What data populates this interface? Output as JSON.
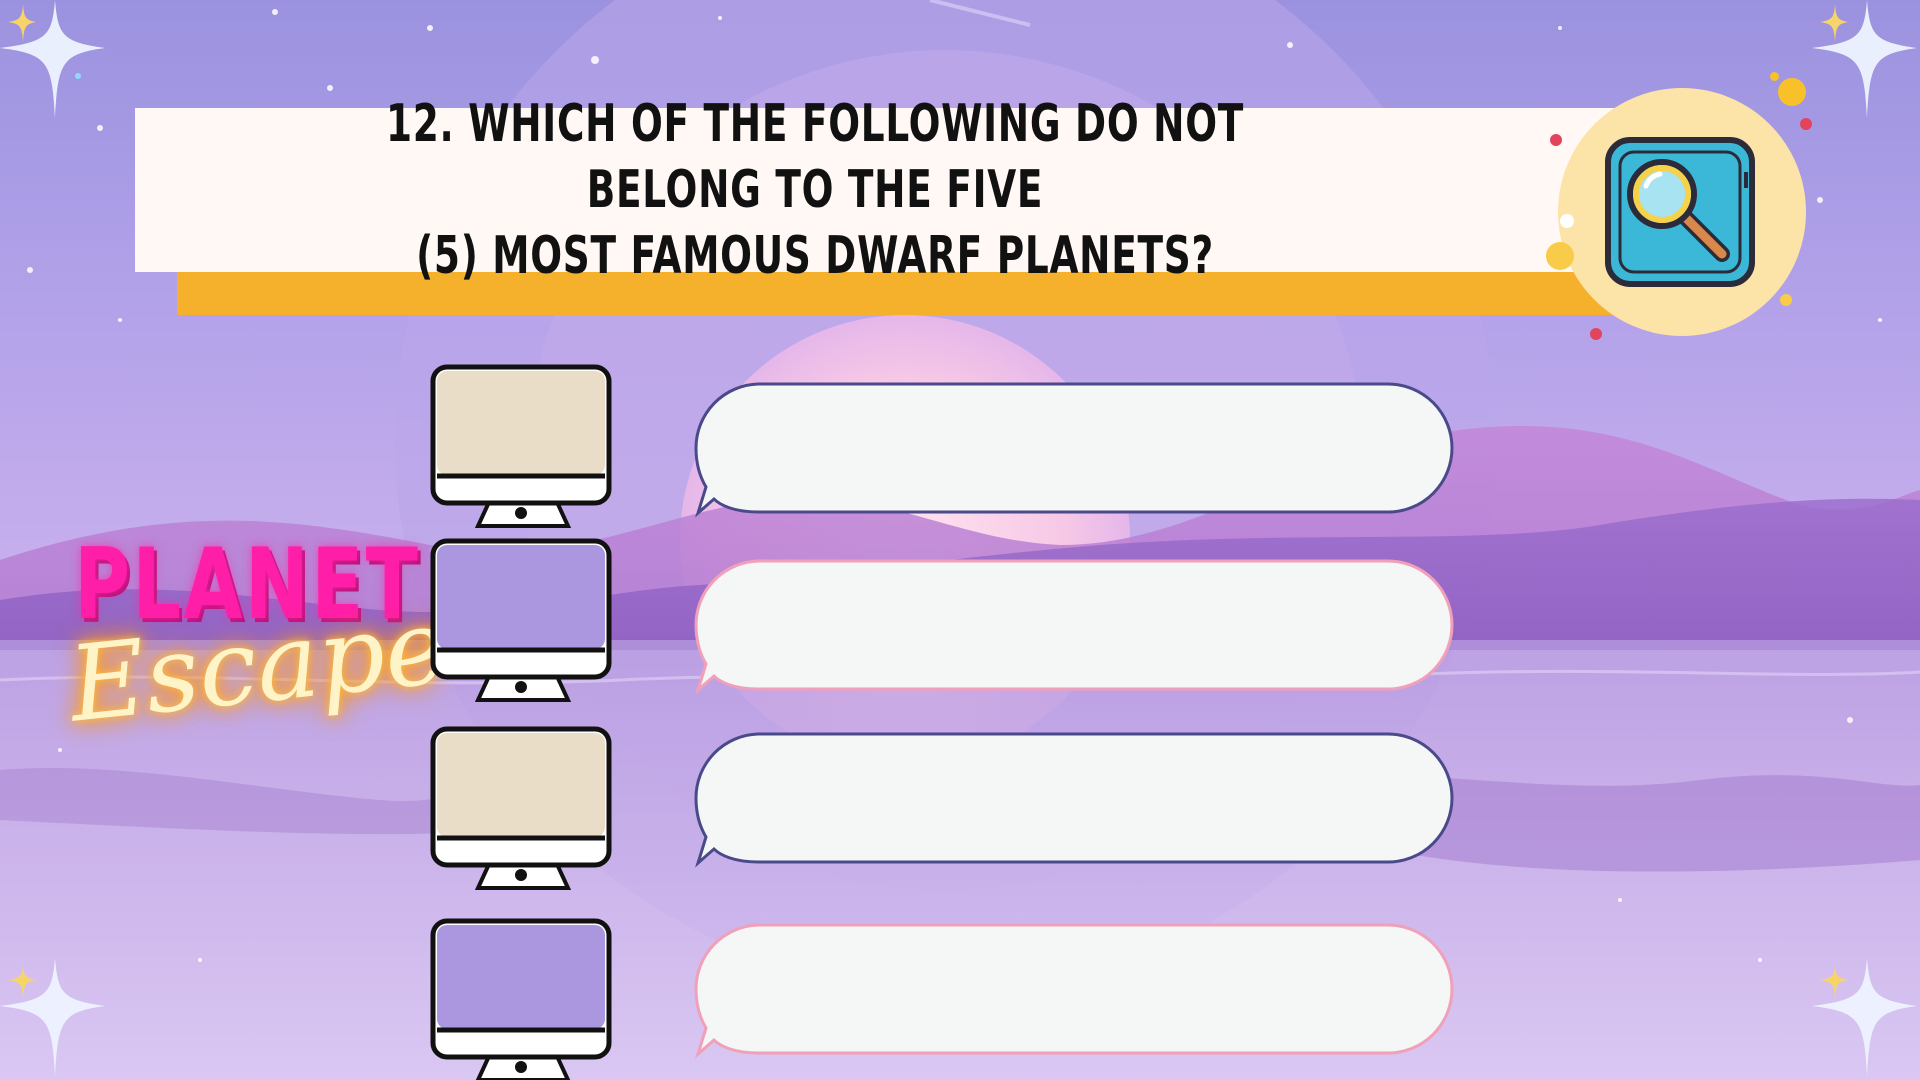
{
  "question": {
    "line1": "12. WHICH OF THE FOLLOWING DO NOT BELONG TO THE FIVE",
    "line2": "(5) MOST FAMOUS DWARF PLANETS?"
  },
  "logo": {
    "line1": "PLANET",
    "line2": "Escape"
  },
  "options": [
    {
      "text": "",
      "screen_color": "#e9ddc7",
      "bubble_border": "#4a4a8a"
    },
    {
      "text": "",
      "screen_color": "#ab97e0",
      "bubble_border": "#f0a0b8"
    },
    {
      "text": "",
      "screen_color": "#e9ddc7",
      "bubble_border": "#4a4a8a"
    },
    {
      "text": "",
      "screen_color": "#ab97e0",
      "bubble_border": "#f0a0b8"
    }
  ],
  "icons": {
    "hint": "magnifier-icon",
    "sparkle": "sparkle-icon",
    "monitor": "monitor-icon"
  },
  "colors": {
    "title_bar_shadow": "#f6b12c",
    "hint_badge": "#fce4a8",
    "logo_pink": "#ff1ea8",
    "logo_glow": "#ffbf3a"
  }
}
